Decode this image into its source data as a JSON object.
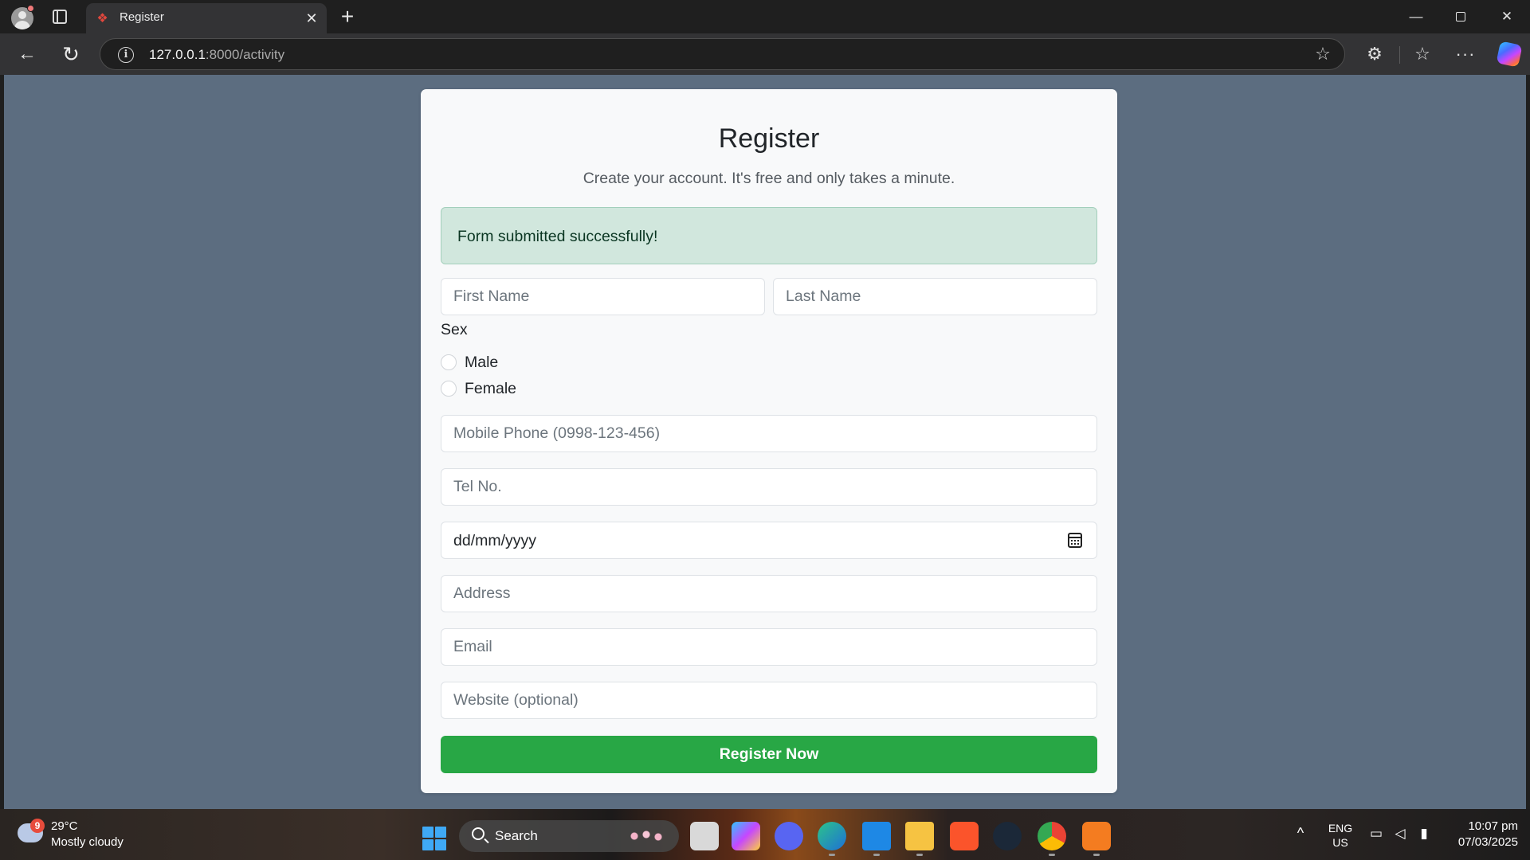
{
  "browser": {
    "tab_title": "Register",
    "tab_favicon": "laravel-logo-icon",
    "url_host": "127.0.0.1",
    "url_path": ":8000/activity",
    "tab_close_glyph": "✕",
    "new_tab_glyph": "+"
  },
  "page": {
    "title": "Register",
    "subtitle": "Create your account. It's free and only takes a minute.",
    "alert_text": "Form submitted successfully!",
    "first_name_placeholder": "First Name",
    "last_name_placeholder": "Last Name",
    "sex_label": "Sex",
    "sex_options": [
      "Male",
      "Female"
    ],
    "mobile_placeholder": "Mobile Phone (0998-123-456)",
    "tel_placeholder": "Tel No.",
    "date_placeholder": "dd/mm/yyyy",
    "address_placeholder": "Address",
    "email_placeholder": "Email",
    "website_placeholder": "Website (optional)",
    "submit_label": "Register Now"
  },
  "taskbar": {
    "weather_temp": "29°C",
    "weather_desc": "Mostly cloudy",
    "weather_badge": "9",
    "search_label": "Search",
    "lang_primary": "ENG",
    "lang_secondary": "US",
    "time": "10:07 pm",
    "date": "07/03/2025",
    "apps": [
      "file-explorer-icon",
      "copilot-app-icon",
      "discord-icon",
      "edge-dev-icon",
      "vscode-icon",
      "folder-icon",
      "brave-icon",
      "steam-icon",
      "chrome-icon",
      "xampp-icon"
    ]
  },
  "colors": {
    "page_background": "#5c6d80",
    "card_background": "#f8f9fa",
    "alert_background": "#d1e7dd",
    "alert_text": "#0a3622",
    "button_background": "#28a745"
  }
}
